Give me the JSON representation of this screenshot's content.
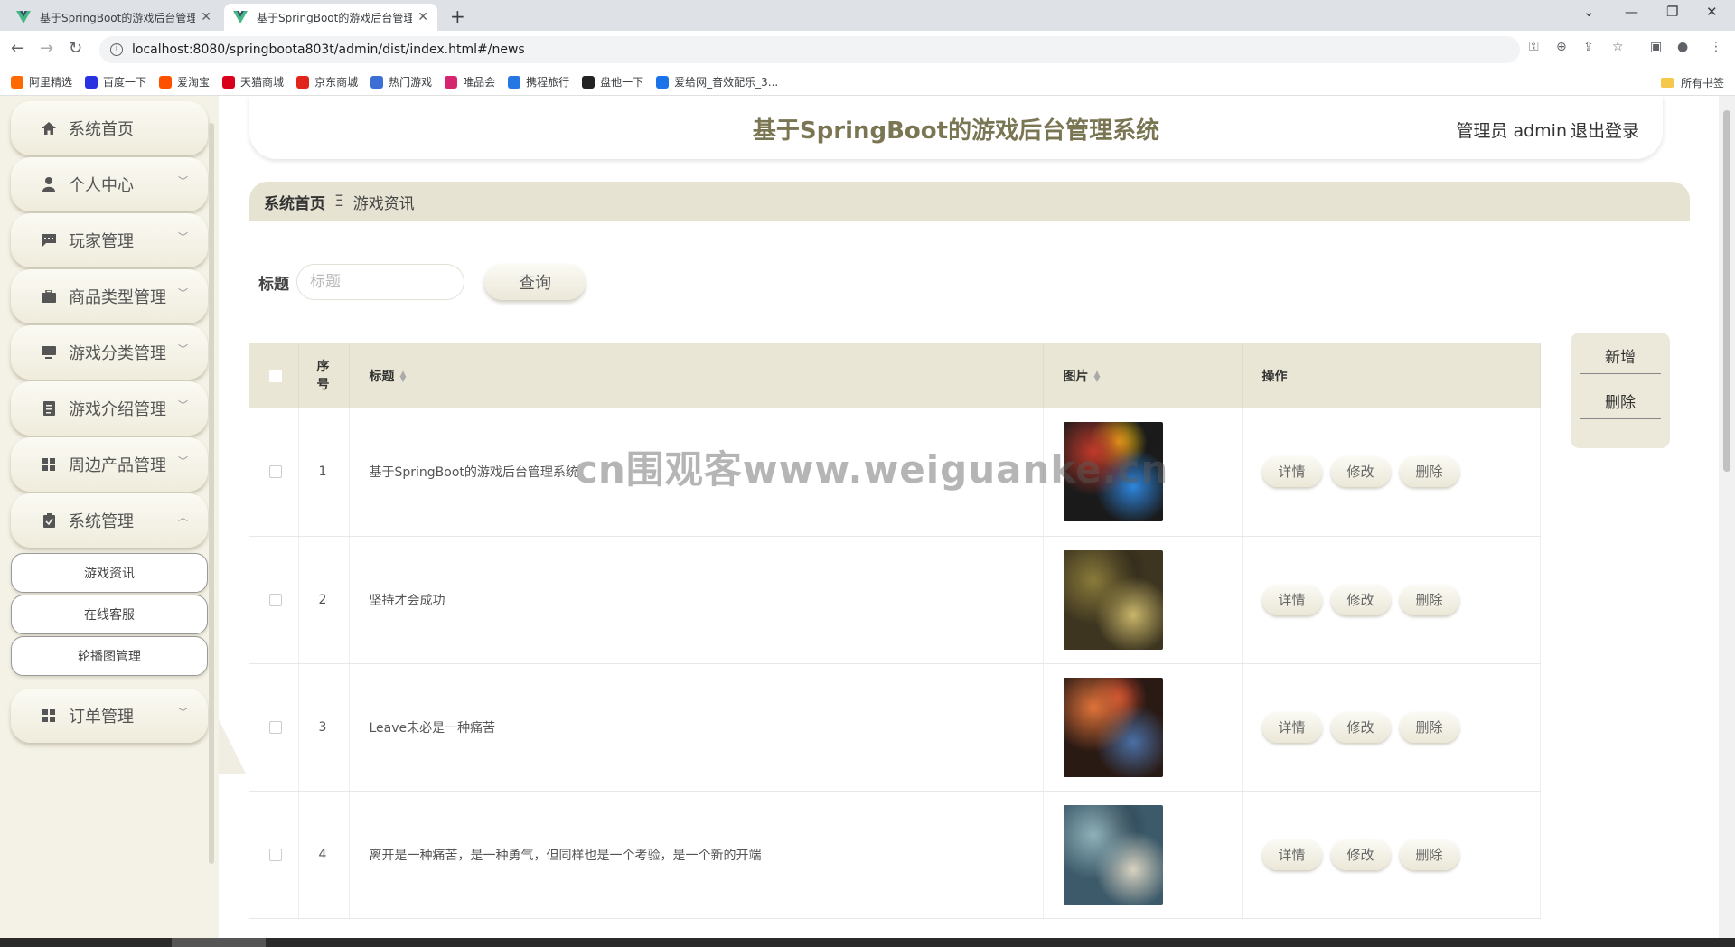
{
  "browser": {
    "tabs": [
      {
        "title": "基于SpringBoot的游戏后台管理"
      },
      {
        "title": "基于SpringBoot的游戏后台管理"
      }
    ],
    "url": "localhost:8080/springboota803t/admin/dist/index.html#/news",
    "bookmarks": [
      {
        "label": "阿里精选",
        "color": "#ff6a00"
      },
      {
        "label": "百度一下",
        "color": "#2932e1"
      },
      {
        "label": "爱淘宝",
        "color": "#ff5000"
      },
      {
        "label": "天猫商城",
        "color": "#d9001b"
      },
      {
        "label": "京东商城",
        "color": "#e1251b"
      },
      {
        "label": "热门游戏",
        "color": "#3b6fd6"
      },
      {
        "label": "唯品会",
        "color": "#d6246e"
      },
      {
        "label": "携程旅行",
        "color": "#2577e3"
      },
      {
        "label": "盘他一下",
        "color": "#222222"
      },
      {
        "label": "爱给网_音效配乐_3...",
        "color": "#1a73e8"
      }
    ],
    "all_bookmarks": "所有书签"
  },
  "sidebar": {
    "items": [
      {
        "label": "系统首页",
        "icon": "home-icon",
        "has_arrow": false
      },
      {
        "label": "个人中心",
        "icon": "user-icon",
        "has_arrow": true
      },
      {
        "label": "玩家管理",
        "icon": "chat-icon",
        "has_arrow": true
      },
      {
        "label": "商品类型管理",
        "icon": "briefcase-icon",
        "has_arrow": true
      },
      {
        "label": "游戏分类管理",
        "icon": "monitor-icon",
        "has_arrow": true
      },
      {
        "label": "游戏介绍管理",
        "icon": "document-icon",
        "has_arrow": true
      },
      {
        "label": "周边产品管理",
        "icon": "grid-icon",
        "has_arrow": true
      },
      {
        "label": "系统管理",
        "icon": "clipboard-icon",
        "has_arrow": true,
        "expanded": true
      }
    ],
    "sub_items": [
      "游戏资讯",
      "在线客服",
      "轮播图管理"
    ],
    "order_item": {
      "label": "订单管理",
      "icon": "grid-icon"
    }
  },
  "header": {
    "title": "基于SpringBoot的游戏后台管理系统",
    "user": "管理员 admin",
    "logout": "退出登录"
  },
  "breadcrumb": {
    "home": "系统首页",
    "separator": "Ξ",
    "current": "游戏资讯"
  },
  "search": {
    "label": "标题",
    "placeholder": "标题",
    "button": "查询"
  },
  "actions": {
    "add": "新增",
    "delete": "删除"
  },
  "table": {
    "columns": {
      "index": "序号",
      "title": "标题",
      "image": "图片",
      "ops": "操作"
    },
    "row_buttons": {
      "detail": "详情",
      "edit": "修改",
      "delete": "删除"
    },
    "rows": [
      {
        "index": "1",
        "title": "基于SpringBoot的游戏后台管理系统",
        "image_colors": [
          "#1a1a1a",
          "#c0392b",
          "#2e86de",
          "#f1c40f"
        ]
      },
      {
        "index": "2",
        "title": "坚持才会成功",
        "image_colors": [
          "#3d3520",
          "#8a7a3a",
          "#c9b66a",
          "#2a2418"
        ]
      },
      {
        "index": "3",
        "title": "Leave未必是一种痛苦",
        "image_colors": [
          "#2a1a14",
          "#e0733a",
          "#4a6fa5",
          "#c6452c"
        ]
      },
      {
        "index": "4",
        "title": "离开是一种痛苦，是一种勇气，但同样也是一个考验，是一个新的开端",
        "image_colors": [
          "#3c5a6a",
          "#8fb0b8",
          "#d8d2c0",
          "#2b3f4c"
        ]
      }
    ]
  },
  "watermark": "cn围观客www.weiguanke.cn"
}
